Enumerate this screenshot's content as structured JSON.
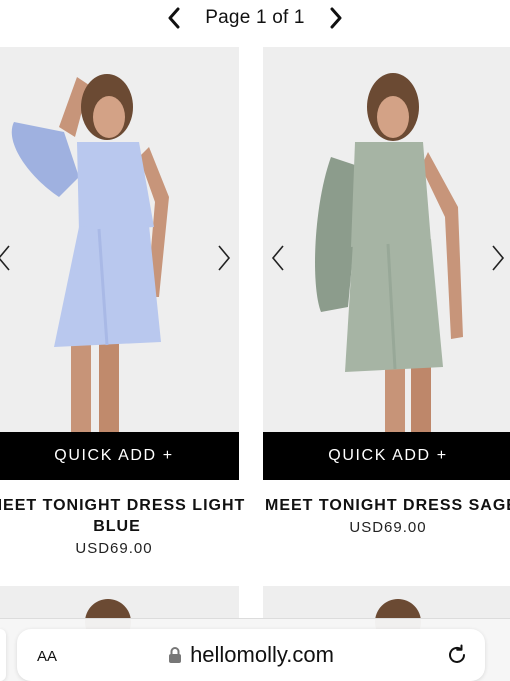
{
  "pagination": {
    "label": "Page 1 of 1"
  },
  "products": [
    {
      "title": "MEET TONIGHT DRESS LIGHT BLUE",
      "price": "USD69.00",
      "quick_add": "QUICK ADD +",
      "dress_color": "#b9c8ee",
      "dress_shade": "#9fb1e0"
    },
    {
      "title": "MEET TONIGHT DRESS SAGE",
      "price": "USD69.00",
      "quick_add": "QUICK ADD +",
      "dress_color": "#a6b4a4",
      "dress_shade": "#8c9c8c"
    }
  ],
  "browser": {
    "text_size_label": "AA",
    "domain": "hellomolly.com",
    "lock_icon": "lock-icon",
    "reload_icon": "reload-icon"
  }
}
